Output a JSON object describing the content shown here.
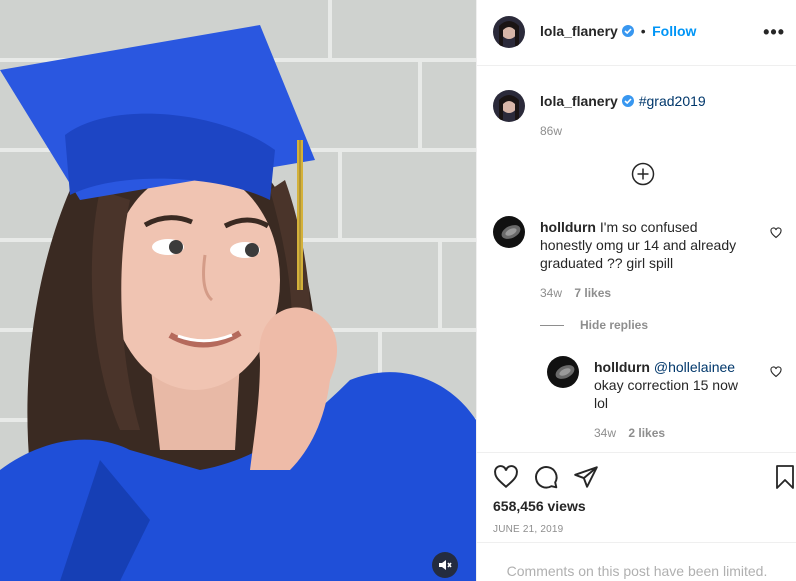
{
  "post": {
    "author": "lola_flanery",
    "follow_label": "Follow",
    "separator": "•",
    "more_label": "•••",
    "caption": {
      "username": "lola_flanery",
      "hashtag": "#grad2019",
      "age": "86w"
    },
    "comments": [
      {
        "username": "holldurn",
        "text": "I'm so confused honestly omg ur 14 and already graduated ?? girl spill",
        "age": "34w",
        "likes": "7 likes",
        "hide_replies_label": "Hide replies",
        "replies": [
          {
            "username": "holldurn",
            "mention": "@hollelainee",
            "text": "okay correction 15 now lol",
            "age": "34w",
            "likes": "2 likes"
          }
        ]
      }
    ],
    "views": "658,456 views",
    "date": "JUNE 21, 2019",
    "comments_limited": "Comments on this post have been limited."
  },
  "colors": {
    "accent": "#0095f6",
    "verified": "#3897f0",
    "link": "#00376b",
    "muted": "#8e8e8e",
    "gown": "#1f4fd8"
  },
  "icons": [
    "heart-icon",
    "comment-icon",
    "share-icon",
    "bookmark-icon",
    "mute-icon",
    "load-more-icon",
    "verified-icon",
    "more-options-icon"
  ]
}
